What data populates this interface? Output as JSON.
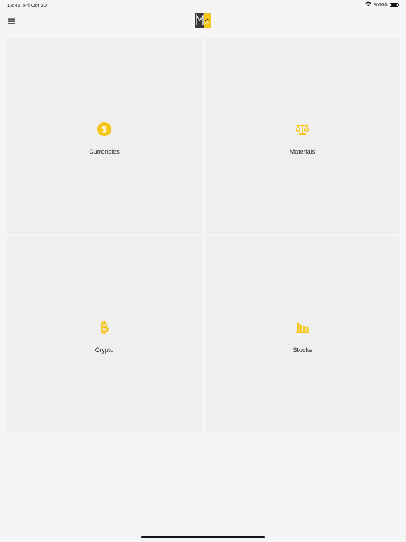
{
  "status_bar": {
    "time": "12:46",
    "date": "Fri Oct 20",
    "battery": "%100",
    "wifi_icon": "wifi-icon",
    "battery_icon": "battery-icon"
  },
  "nav": {
    "menu_icon": "hamburger-menu-icon",
    "logo_icon": "app-logo"
  },
  "tiles": [
    {
      "label": "Currencies",
      "icon": "dollar-coin-icon"
    },
    {
      "label": "Materials",
      "icon": "balance-scale-icon"
    },
    {
      "label": "Crypto",
      "icon": "bitcoin-icon"
    },
    {
      "label": "Stocks",
      "icon": "stock-bars-icon"
    }
  ],
  "colors": {
    "accent": "#f5c518",
    "background": "#f5f5f5",
    "tile": "#efefef",
    "logo_dark": "#3a3a3a"
  }
}
